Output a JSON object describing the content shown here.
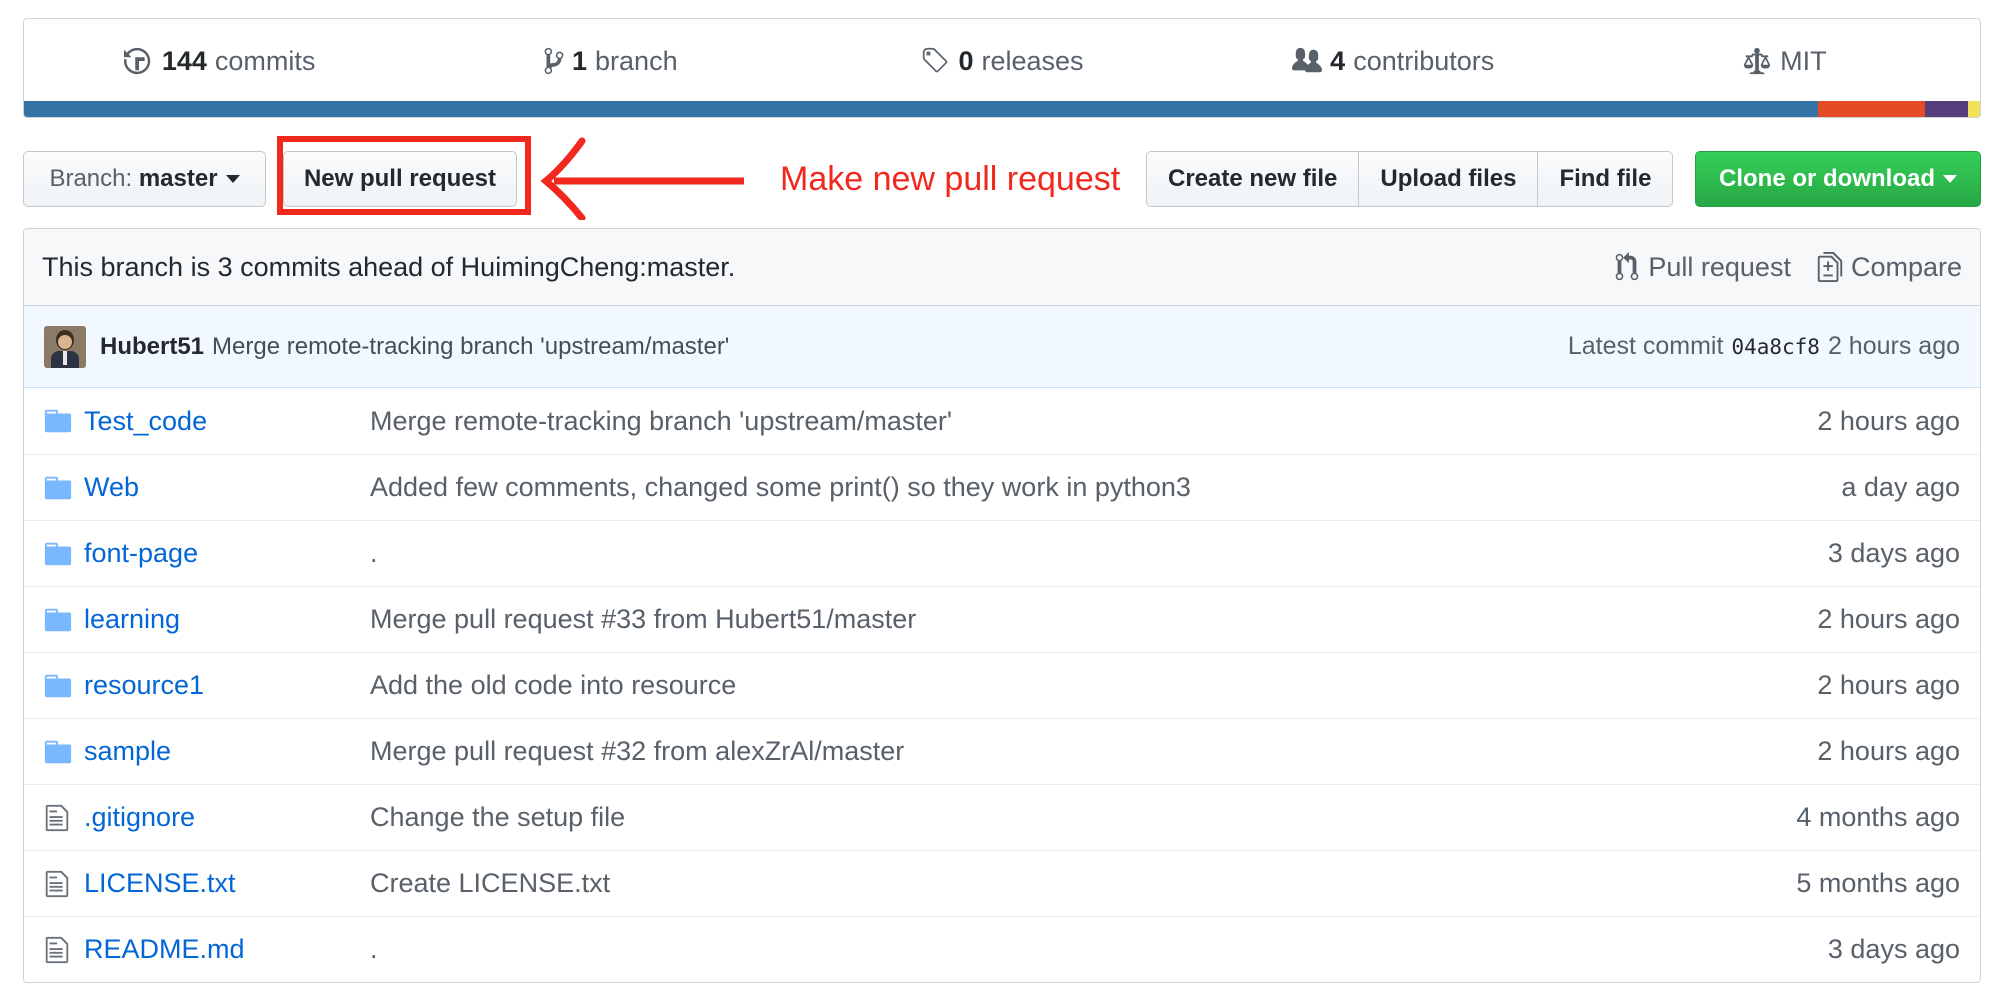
{
  "summary": {
    "commits_num": "144",
    "commits_label": "commits",
    "branch_num": "1",
    "branch_label": "branch",
    "releases_num": "0",
    "releases_label": "releases",
    "contributors_num": "4",
    "contributors_label": "contributors",
    "license": "MIT"
  },
  "language_bar": [
    {
      "color": "#3572A5",
      "percent": 91.7
    },
    {
      "color": "#e34c26",
      "percent": 5.5
    },
    {
      "color": "#563d7c",
      "percent": 2.2
    },
    {
      "color": "#f1e05a",
      "percent": 0.6
    }
  ],
  "toolbar": {
    "branch_prefix": "Branch:",
    "branch_name": "master",
    "new_pr_label": "New pull request",
    "create_file_label": "Create new file",
    "upload_files_label": "Upload files",
    "find_file_label": "Find file",
    "clone_label": "Clone or download"
  },
  "annotation": {
    "text": "Make new pull request",
    "color": "#f0281e"
  },
  "branch_info": {
    "text": "This branch is 3 commits ahead of HuimingCheng:master.",
    "pull_request_label": "Pull request",
    "compare_label": "Compare"
  },
  "latest_commit": {
    "author": "Hubert51",
    "message": "Merge remote-tracking branch 'upstream/master'",
    "prefix": "Latest commit",
    "sha": "04a8cf8",
    "age": "2 hours ago"
  },
  "files": [
    {
      "type": "folder",
      "name": "Test_code",
      "message": "Merge remote-tracking branch 'upstream/master'",
      "age": "2 hours ago"
    },
    {
      "type": "folder",
      "name": "Web",
      "message": "Added few comments, changed some print() so they work in python3",
      "age": "a day ago"
    },
    {
      "type": "folder",
      "name": "font-page",
      "message": ".",
      "age": "3 days ago"
    },
    {
      "type": "folder",
      "name": "learning",
      "message": "Merge pull request #33 from Hubert51/master",
      "age": "2 hours ago"
    },
    {
      "type": "folder",
      "name": "resource1",
      "message": "Add the old code into resource",
      "age": "2 hours ago"
    },
    {
      "type": "folder",
      "name": "sample",
      "message": "Merge pull request #32 from alexZrAl/master",
      "age": "2 hours ago"
    },
    {
      "type": "file",
      "name": ".gitignore",
      "message": "Change the setup file",
      "age": "4 months ago"
    },
    {
      "type": "file",
      "name": "LICENSE.txt",
      "message": "Create LICENSE.txt",
      "age": "5 months ago"
    },
    {
      "type": "file",
      "name": "README.md",
      "message": ".",
      "age": "3 days ago"
    }
  ]
}
